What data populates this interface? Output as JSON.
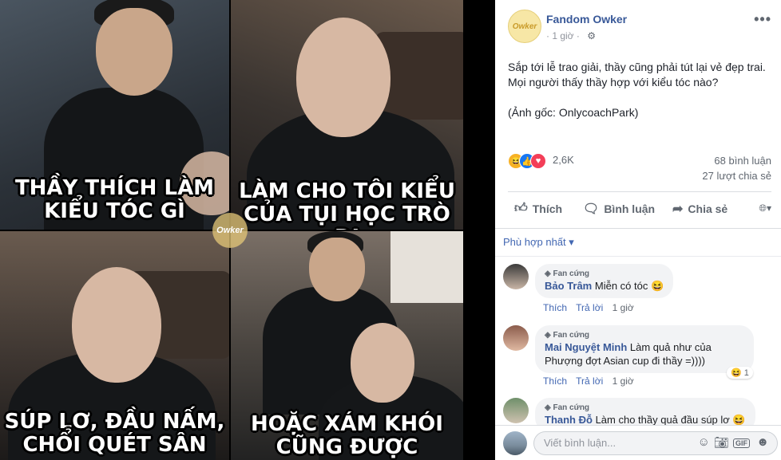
{
  "memes": {
    "panel1": "THẦY THÍCH LÀM\nKIỂU TÓC GÌ",
    "panel2": "LÀM CHO TÔI KIỂU\nCỦA TỤI HỌC TRÒ ĐI",
    "panel3": "SÚP LƠ, ĐẦU NẤM,\nCHỔI QUÉT SÂN",
    "panel4": "HOẶC XÁM KHÓI\nCŨNG ĐƯỢC",
    "watermark": "Owker"
  },
  "post": {
    "page_name": "Fandom Owker",
    "avatar_text": "Owker",
    "time": "· 1 giờ ·",
    "settings_icon": "gear-icon",
    "more": "•••",
    "text": "Sắp tới lễ trao giải, thầy cũng phải tút lại vẻ đẹp trai.\nMọi người thấy thầy hợp với kiểu tóc nào?\n\n(Ảnh gốc: OnlycoachPark)",
    "reaction_count": "2,6K",
    "comment_count": "68 bình luận",
    "share_count": "27 lượt chia sẻ"
  },
  "actions": {
    "like": "Thích",
    "comment": "Bình luận",
    "share": "Chia sẻ"
  },
  "sort_filter": "Phù hợp nhất ▾",
  "comments": [
    {
      "badge": "◈ Fan cứng",
      "author": "Bảo Trâm",
      "text": "Miễn có tóc 😆",
      "like": "Thích",
      "reply": "Trả lời",
      "time": "1 giờ"
    },
    {
      "badge": "◈ Fan cứng",
      "author": "Mai Nguyệt Minh",
      "text": "Làm quả như của Phượng đợt Asian cup đi thầy =))))",
      "like": "Thích",
      "reply": "Trả lời",
      "time": "1 giờ",
      "reaction": "😆 1"
    },
    {
      "badge": "◈ Fan cứng",
      "author": "Thanh Đỗ",
      "text": "Làm cho thầy quả đầu súp lơ 😆"
    }
  ],
  "composer": {
    "placeholder": "Viết bình luận..."
  }
}
